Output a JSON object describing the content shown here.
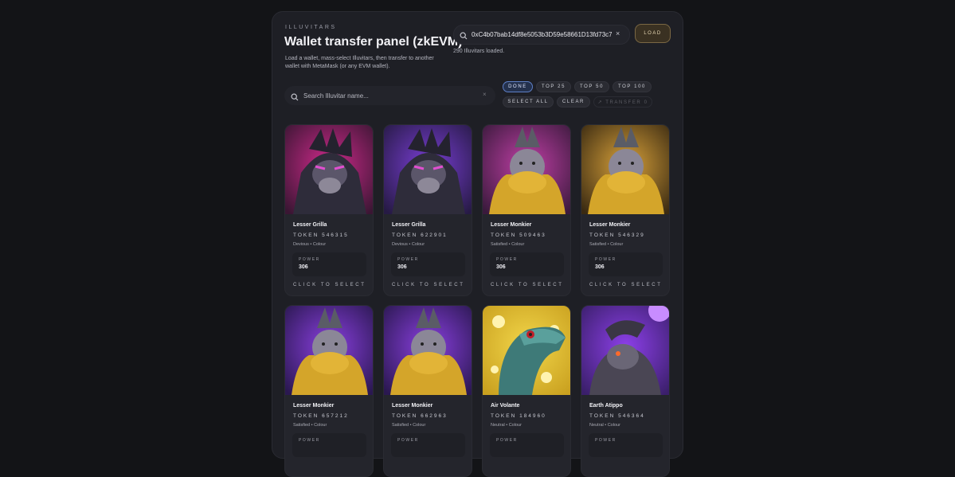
{
  "header": {
    "eyebrow": "ILLUVITARS",
    "title": "Wallet transfer panel (zkEVM)",
    "description": "Load a wallet, mass-select Illuvitars, then transfer to another wallet with MetaMask (or any EVM wallet)."
  },
  "wallet": {
    "address_value": "0xC4b07bab14df8e5053b3D59e58661D13fd73c7f",
    "clear_icon": "×",
    "load_label": "LOAD",
    "status": "290 Illuvitars loaded."
  },
  "search": {
    "placeholder": "Search Illuvitar name...",
    "clear_icon": "×"
  },
  "chips": {
    "done": "DONE",
    "top25": "TOP 25",
    "top50": "TOP 50",
    "top100": "TOP 100",
    "select_all": "SELECT ALL",
    "clear": "CLEAR",
    "transfer": "↗ TRANSFER 0"
  },
  "cards": [
    {
      "name": "Lesser Grilla",
      "token": "TOKEN 546315",
      "traits": "Devious • Colour",
      "power_label": "POWER",
      "power": "306",
      "cta": "CLICK TO SELECT",
      "art": "grilla-pink"
    },
    {
      "name": "Lesser Grilla",
      "token": "TOKEN 622901",
      "traits": "Devious • Colour",
      "power_label": "POWER",
      "power": "306",
      "cta": "CLICK TO SELECT",
      "art": "grilla-purple"
    },
    {
      "name": "Lesser Monkier",
      "token": "TOKEN 509463",
      "traits": "Satisfied • Colour",
      "power_label": "POWER",
      "power": "306",
      "cta": "CLICK TO SELECT",
      "art": "monkier-pink"
    },
    {
      "name": "Lesser Monkier",
      "token": "TOKEN 546329",
      "traits": "Satisfied • Colour",
      "power_label": "POWER",
      "power": "306",
      "cta": "CLICK TO SELECT",
      "art": "monkier-gold"
    },
    {
      "name": "Lesser Monkier",
      "token": "TOKEN 657212",
      "traits": "Satisfied • Colour",
      "power_label": "POWER",
      "power": "",
      "cta": "",
      "art": "monkier-purple"
    },
    {
      "name": "Lesser Monkier",
      "token": "TOKEN 662963",
      "traits": "Satisfied • Colour",
      "power_label": "POWER",
      "power": "",
      "cta": "",
      "art": "monkier-purple"
    },
    {
      "name": "Air Volante",
      "token": "TOKEN 184960",
      "traits": "Neutral • Colour",
      "power_label": "POWER",
      "power": "",
      "cta": "",
      "art": "volante"
    },
    {
      "name": "Earth Atippo",
      "token": "TOKEN 546364",
      "traits": "Neutral • Colour",
      "power_label": "POWER",
      "power": "",
      "cta": "",
      "art": "atippo"
    }
  ],
  "colors": {
    "background": "#131417",
    "panel": "#1e1f25",
    "accent_blue": "#5d7fc6",
    "accent_gold": "#7b6844"
  }
}
